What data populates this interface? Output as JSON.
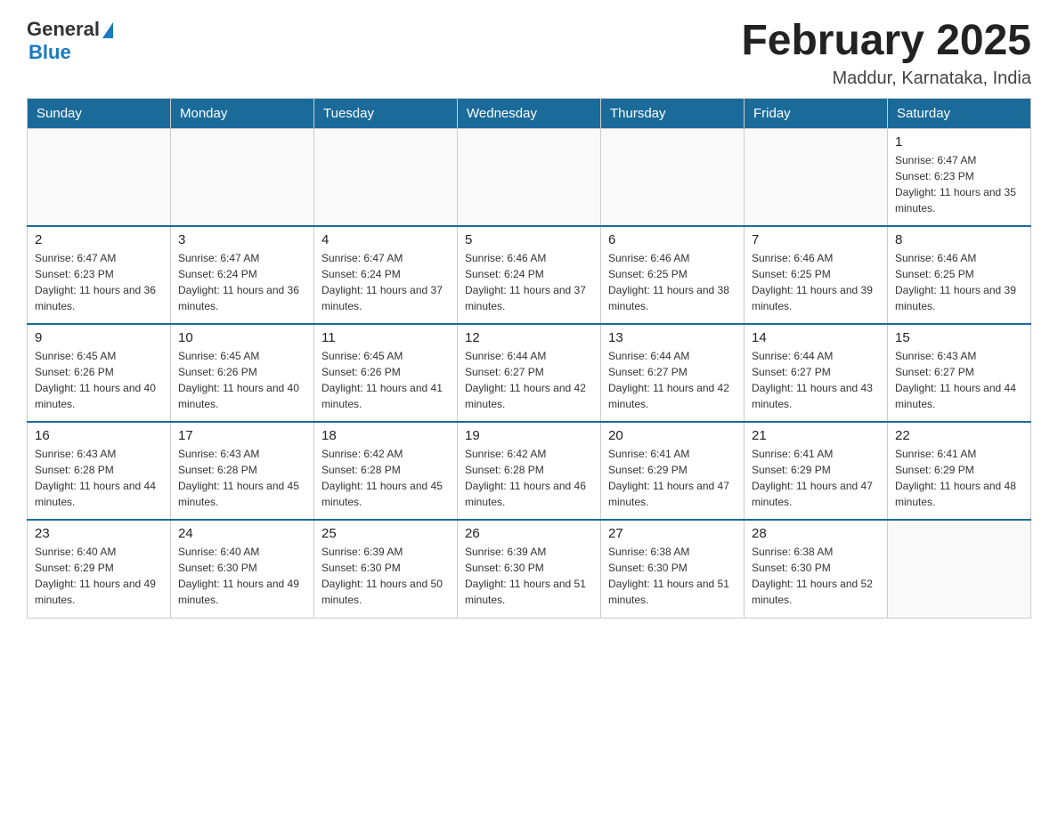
{
  "header": {
    "logo_general": "General",
    "logo_blue": "Blue",
    "month_title": "February 2025",
    "location": "Maddur, Karnataka, India"
  },
  "days_of_week": [
    "Sunday",
    "Monday",
    "Tuesday",
    "Wednesday",
    "Thursday",
    "Friday",
    "Saturday"
  ],
  "weeks": [
    [
      {
        "day": "",
        "sunrise": "",
        "sunset": "",
        "daylight": ""
      },
      {
        "day": "",
        "sunrise": "",
        "sunset": "",
        "daylight": ""
      },
      {
        "day": "",
        "sunrise": "",
        "sunset": "",
        "daylight": ""
      },
      {
        "day": "",
        "sunrise": "",
        "sunset": "",
        "daylight": ""
      },
      {
        "day": "",
        "sunrise": "",
        "sunset": "",
        "daylight": ""
      },
      {
        "day": "",
        "sunrise": "",
        "sunset": "",
        "daylight": ""
      },
      {
        "day": "1",
        "sunrise": "Sunrise: 6:47 AM",
        "sunset": "Sunset: 6:23 PM",
        "daylight": "Daylight: 11 hours and 35 minutes."
      }
    ],
    [
      {
        "day": "2",
        "sunrise": "Sunrise: 6:47 AM",
        "sunset": "Sunset: 6:23 PM",
        "daylight": "Daylight: 11 hours and 36 minutes."
      },
      {
        "day": "3",
        "sunrise": "Sunrise: 6:47 AM",
        "sunset": "Sunset: 6:24 PM",
        "daylight": "Daylight: 11 hours and 36 minutes."
      },
      {
        "day": "4",
        "sunrise": "Sunrise: 6:47 AM",
        "sunset": "Sunset: 6:24 PM",
        "daylight": "Daylight: 11 hours and 37 minutes."
      },
      {
        "day": "5",
        "sunrise": "Sunrise: 6:46 AM",
        "sunset": "Sunset: 6:24 PM",
        "daylight": "Daylight: 11 hours and 37 minutes."
      },
      {
        "day": "6",
        "sunrise": "Sunrise: 6:46 AM",
        "sunset": "Sunset: 6:25 PM",
        "daylight": "Daylight: 11 hours and 38 minutes."
      },
      {
        "day": "7",
        "sunrise": "Sunrise: 6:46 AM",
        "sunset": "Sunset: 6:25 PM",
        "daylight": "Daylight: 11 hours and 39 minutes."
      },
      {
        "day": "8",
        "sunrise": "Sunrise: 6:46 AM",
        "sunset": "Sunset: 6:25 PM",
        "daylight": "Daylight: 11 hours and 39 minutes."
      }
    ],
    [
      {
        "day": "9",
        "sunrise": "Sunrise: 6:45 AM",
        "sunset": "Sunset: 6:26 PM",
        "daylight": "Daylight: 11 hours and 40 minutes."
      },
      {
        "day": "10",
        "sunrise": "Sunrise: 6:45 AM",
        "sunset": "Sunset: 6:26 PM",
        "daylight": "Daylight: 11 hours and 40 minutes."
      },
      {
        "day": "11",
        "sunrise": "Sunrise: 6:45 AM",
        "sunset": "Sunset: 6:26 PM",
        "daylight": "Daylight: 11 hours and 41 minutes."
      },
      {
        "day": "12",
        "sunrise": "Sunrise: 6:44 AM",
        "sunset": "Sunset: 6:27 PM",
        "daylight": "Daylight: 11 hours and 42 minutes."
      },
      {
        "day": "13",
        "sunrise": "Sunrise: 6:44 AM",
        "sunset": "Sunset: 6:27 PM",
        "daylight": "Daylight: 11 hours and 42 minutes."
      },
      {
        "day": "14",
        "sunrise": "Sunrise: 6:44 AM",
        "sunset": "Sunset: 6:27 PM",
        "daylight": "Daylight: 11 hours and 43 minutes."
      },
      {
        "day": "15",
        "sunrise": "Sunrise: 6:43 AM",
        "sunset": "Sunset: 6:27 PM",
        "daylight": "Daylight: 11 hours and 44 minutes."
      }
    ],
    [
      {
        "day": "16",
        "sunrise": "Sunrise: 6:43 AM",
        "sunset": "Sunset: 6:28 PM",
        "daylight": "Daylight: 11 hours and 44 minutes."
      },
      {
        "day": "17",
        "sunrise": "Sunrise: 6:43 AM",
        "sunset": "Sunset: 6:28 PM",
        "daylight": "Daylight: 11 hours and 45 minutes."
      },
      {
        "day": "18",
        "sunrise": "Sunrise: 6:42 AM",
        "sunset": "Sunset: 6:28 PM",
        "daylight": "Daylight: 11 hours and 45 minutes."
      },
      {
        "day": "19",
        "sunrise": "Sunrise: 6:42 AM",
        "sunset": "Sunset: 6:28 PM",
        "daylight": "Daylight: 11 hours and 46 minutes."
      },
      {
        "day": "20",
        "sunrise": "Sunrise: 6:41 AM",
        "sunset": "Sunset: 6:29 PM",
        "daylight": "Daylight: 11 hours and 47 minutes."
      },
      {
        "day": "21",
        "sunrise": "Sunrise: 6:41 AM",
        "sunset": "Sunset: 6:29 PM",
        "daylight": "Daylight: 11 hours and 47 minutes."
      },
      {
        "day": "22",
        "sunrise": "Sunrise: 6:41 AM",
        "sunset": "Sunset: 6:29 PM",
        "daylight": "Daylight: 11 hours and 48 minutes."
      }
    ],
    [
      {
        "day": "23",
        "sunrise": "Sunrise: 6:40 AM",
        "sunset": "Sunset: 6:29 PM",
        "daylight": "Daylight: 11 hours and 49 minutes."
      },
      {
        "day": "24",
        "sunrise": "Sunrise: 6:40 AM",
        "sunset": "Sunset: 6:30 PM",
        "daylight": "Daylight: 11 hours and 49 minutes."
      },
      {
        "day": "25",
        "sunrise": "Sunrise: 6:39 AM",
        "sunset": "Sunset: 6:30 PM",
        "daylight": "Daylight: 11 hours and 50 minutes."
      },
      {
        "day": "26",
        "sunrise": "Sunrise: 6:39 AM",
        "sunset": "Sunset: 6:30 PM",
        "daylight": "Daylight: 11 hours and 51 minutes."
      },
      {
        "day": "27",
        "sunrise": "Sunrise: 6:38 AM",
        "sunset": "Sunset: 6:30 PM",
        "daylight": "Daylight: 11 hours and 51 minutes."
      },
      {
        "day": "28",
        "sunrise": "Sunrise: 6:38 AM",
        "sunset": "Sunset: 6:30 PM",
        "daylight": "Daylight: 11 hours and 52 minutes."
      },
      {
        "day": "",
        "sunrise": "",
        "sunset": "",
        "daylight": ""
      }
    ]
  ]
}
